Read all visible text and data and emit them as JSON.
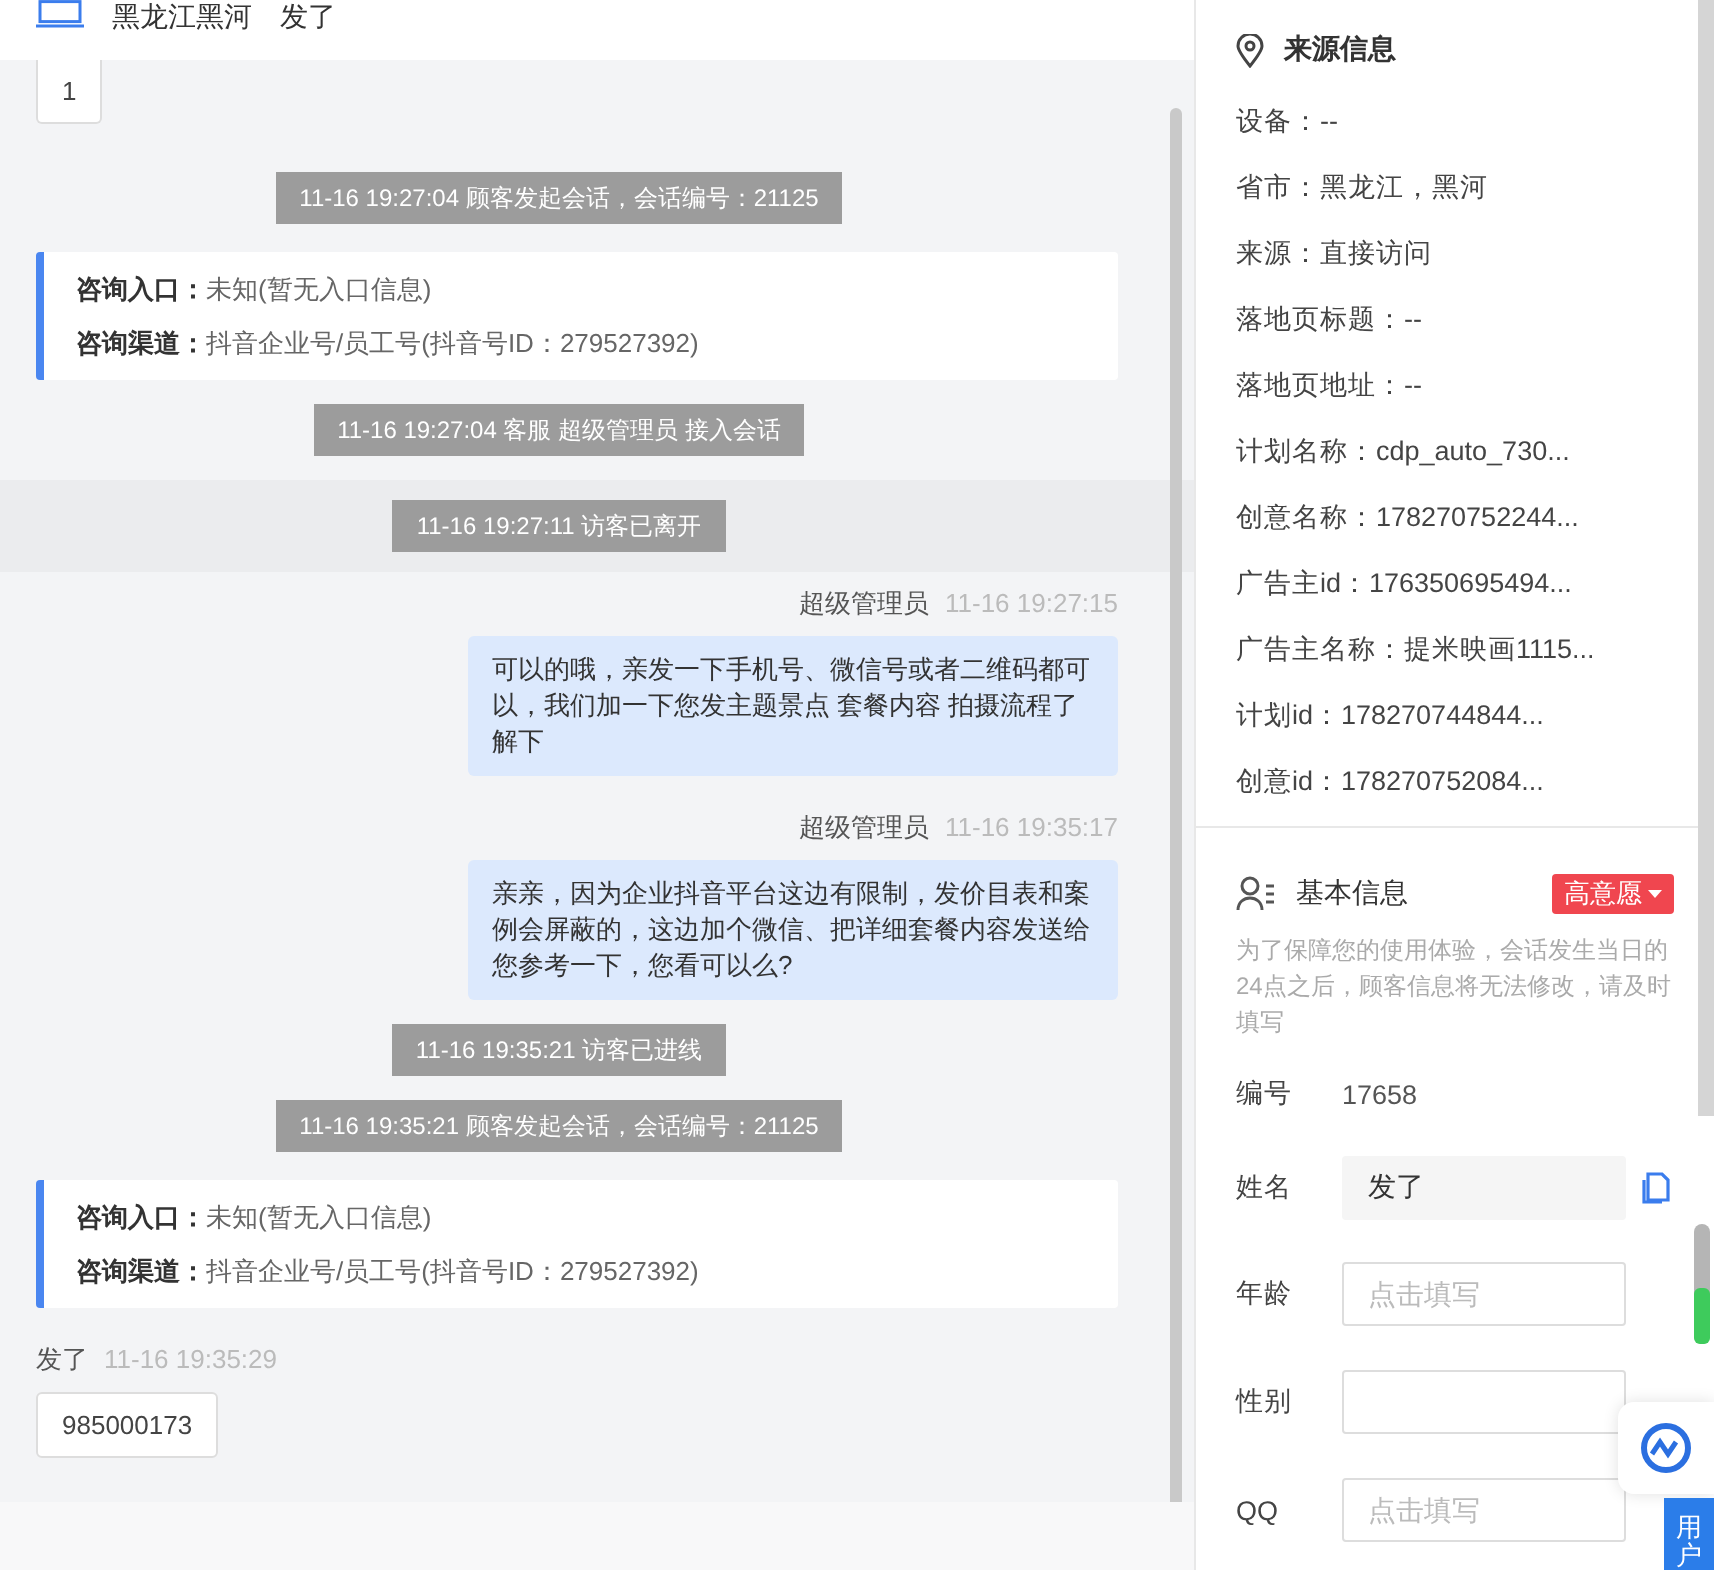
{
  "header": {
    "location": "黑龙江黑河",
    "visitor": "发了"
  },
  "messages": [
    {
      "kind": "visitor_bubble",
      "text": "1"
    },
    {
      "kind": "system",
      "text": "11-16 19:27:04 顾客发起会话，会话编号：21125"
    },
    {
      "kind": "source_card",
      "lines": [
        {
          "label": "咨询入口：",
          "value": "未知(暂无入口信息)"
        },
        {
          "label": "咨询渠道：",
          "value": "抖音企业号/员工号(抖音号ID：279527392)"
        }
      ]
    },
    {
      "kind": "system",
      "text": "11-16 19:27:04 客服 超级管理员 接入会话"
    },
    {
      "kind": "system_band",
      "text": "11-16 19:27:11 访客已离开"
    },
    {
      "kind": "agent",
      "sender": "超级管理员",
      "time": "11-16 19:27:15",
      "text": "可以的哦，亲发一下手机号、微信号或者二维码都可以，我们加一下您发主题景点 套餐内容 拍摄流程了解下"
    },
    {
      "kind": "agent",
      "sender": "超级管理员",
      "time": "11-16 19:35:17",
      "text": "亲亲，因为企业抖音平台这边有限制，发价目表和案例会屏蔽的，这边加个微信、把详细套餐内容发送给您参考一下，您看可以么?"
    },
    {
      "kind": "system",
      "text": "11-16 19:35:21 访客已进线"
    },
    {
      "kind": "system",
      "text": "11-16 19:35:21 顾客发起会话，会话编号：21125"
    },
    {
      "kind": "source_card",
      "lines": [
        {
          "label": "咨询入口：",
          "value": "未知(暂无入口信息)"
        },
        {
          "label": "咨询渠道：",
          "value": "抖音企业号/员工号(抖音号ID：279527392)"
        }
      ]
    },
    {
      "kind": "visitor",
      "sender": "发了",
      "time": "11-16 19:35:29",
      "text": "985000173"
    }
  ],
  "source_info": {
    "title": "来源信息",
    "items": [
      "设备：--",
      "省市：黑龙江，黑河",
      "来源：直接访问",
      "落地页标题：--",
      "落地页地址：--",
      "计划名称：cdp_auto_730...",
      "创意名称：178270752244...",
      "广告主id：176350695494...",
      "广告主名称：提米映画1115...",
      "计划id：178270744844...",
      "创意id：178270752084..."
    ]
  },
  "basic_info": {
    "title": "基本信息",
    "intent_tag": "高意愿",
    "notice": "为了保障您的使用体验，会话发生当日的24点之后，顾客信息将无法修改，请及时填写",
    "fields": [
      {
        "kind": "readonly",
        "label": "编号",
        "value": "17658"
      },
      {
        "kind": "filled",
        "label": "姓名",
        "value": "发了"
      },
      {
        "kind": "input",
        "label": "年龄",
        "placeholder": "点击填写"
      },
      {
        "kind": "input",
        "label": "性别"
      },
      {
        "kind": "input",
        "label": "QQ",
        "placeholder": "点击填写"
      }
    ]
  },
  "user_tab": "用户"
}
